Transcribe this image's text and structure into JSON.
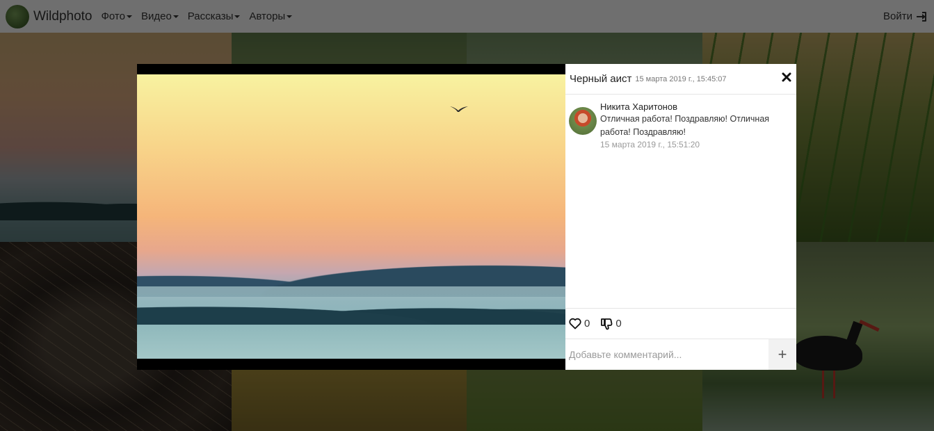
{
  "navbar": {
    "brand": "Wildphoto",
    "menu": [
      {
        "label": "Фото"
      },
      {
        "label": "Видео"
      },
      {
        "label": "Рассказы"
      },
      {
        "label": "Авторы"
      }
    ],
    "login": "Войти"
  },
  "modal": {
    "title": "Черный аист",
    "date": "15 марта 2019 г., 15:45:07",
    "comments": [
      {
        "author": "Никита Харитонов",
        "text": "Отличная работа! Поздравляю! Отличная работа! Поздравляю!",
        "date": "15 марта 2019 г., 15:51:20"
      }
    ],
    "likes": "0",
    "dislikes": "0",
    "comment_placeholder": "Добавьте комментарий...",
    "add_button": "+"
  },
  "icons": [
    "logo-icon",
    "caret-down-icon",
    "sign-in-icon",
    "close-icon",
    "heart-icon",
    "thumbs-down-icon",
    "plus-icon"
  ],
  "colors": {
    "navbar_bg": "#f5f5f5",
    "overlay": "rgba(0,0,0,0.55)",
    "panel_bg": "#ffffff"
  }
}
